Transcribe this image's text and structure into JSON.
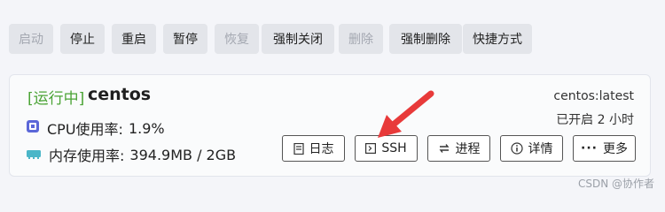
{
  "toolbar": {
    "start": "启动",
    "stop": "停止",
    "restart": "重启",
    "pause": "暂停",
    "resume": "恢复",
    "force_close": "强制关闭",
    "delete": "删除",
    "force_delete": "强制删除",
    "shortcut": "快捷方式"
  },
  "container": {
    "status": "[运行中]",
    "name": "centos",
    "image": "centos:latest",
    "uptime": "已开启 2 小时",
    "cpu_label": "CPU使用率:",
    "cpu_value": "1.9%",
    "mem_label": "内存使用率:",
    "mem_value": "394.9MB / 2GB"
  },
  "actions": {
    "logs": "日志",
    "ssh": "SSH",
    "process": "进程",
    "details": "详情",
    "more": "更多"
  },
  "watermark": "CSDN @协作者",
  "colors": {
    "running": "#4aa335",
    "cpu_icon": "#5b67d8",
    "mem_icon": "#4bb6c8",
    "arrow": "#e83a3a"
  }
}
